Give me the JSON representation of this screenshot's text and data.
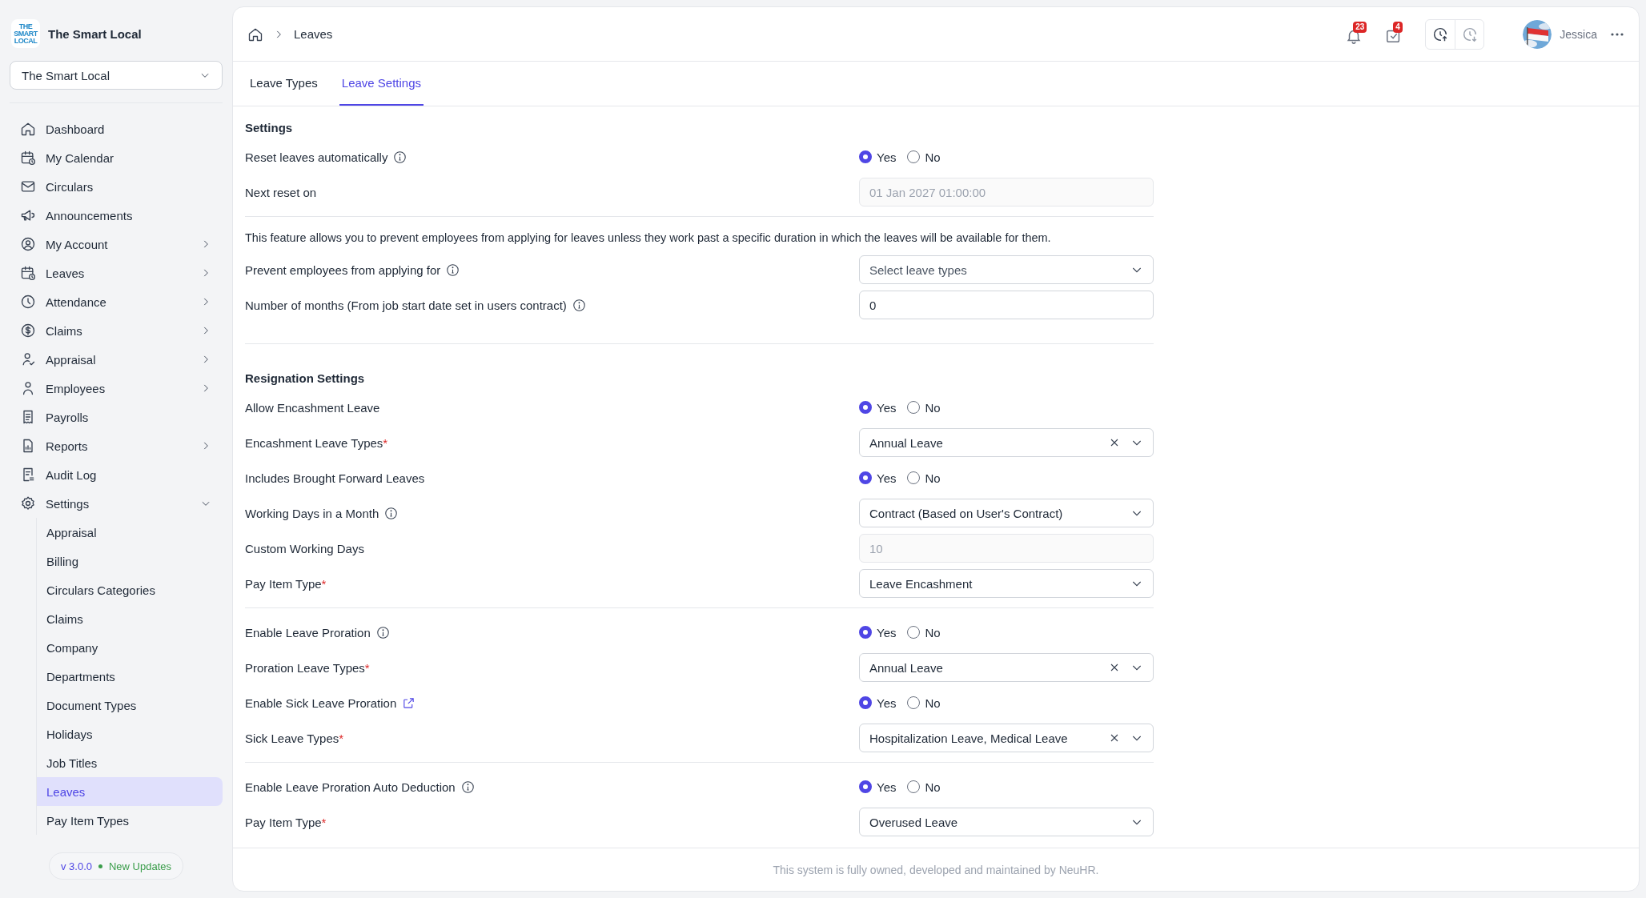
{
  "brand": {
    "logo_text": "THE SMART LOCAL",
    "name": "The Smart Local"
  },
  "company_select": {
    "value": "The Smart Local"
  },
  "sidebar": {
    "items": [
      {
        "label": "Dashboard"
      },
      {
        "label": "My Calendar"
      },
      {
        "label": "Circulars"
      },
      {
        "label": "Announcements"
      },
      {
        "label": "My Account",
        "expanded": false
      },
      {
        "label": "Leaves",
        "expanded": false
      },
      {
        "label": "Attendance",
        "expanded": false
      },
      {
        "label": "Claims",
        "expanded": false
      },
      {
        "label": "Appraisal",
        "expanded": false
      },
      {
        "label": "Employees",
        "expanded": false
      },
      {
        "label": "Payrolls"
      },
      {
        "label": "Reports",
        "expanded": false
      },
      {
        "label": "Audit Log"
      },
      {
        "label": "Settings",
        "expanded": true,
        "children": [
          {
            "label": "Appraisal",
            "selected": false
          },
          {
            "label": "Billing",
            "selected": false
          },
          {
            "label": "Circulars Categories",
            "selected": false
          },
          {
            "label": "Claims",
            "selected": false
          },
          {
            "label": "Company",
            "selected": false
          },
          {
            "label": "Departments",
            "selected": false
          },
          {
            "label": "Document Types",
            "selected": false
          },
          {
            "label": "Holidays",
            "selected": false
          },
          {
            "label": "Job Titles",
            "selected": false
          },
          {
            "label": "Leaves",
            "selected": true
          },
          {
            "label": "Pay Item Types",
            "selected": false
          }
        ]
      }
    ]
  },
  "version": {
    "number": "v 3.0.0",
    "note": "New Updates"
  },
  "breadcrumb": [
    "Leaves"
  ],
  "header": {
    "notifications": "23",
    "tasks": "4",
    "user": "Jessica"
  },
  "tabs": [
    {
      "label": "Leave Types",
      "selected": false
    },
    {
      "label": "Leave Settings",
      "selected": true
    }
  ],
  "form": [
    {
      "kind": "heading",
      "label": "Settings"
    },
    {
      "kind": "radio",
      "label": "Reset leaves automatically",
      "info": true,
      "options": [
        {
          "label": "Yes",
          "selected": true
        },
        {
          "label": "No",
          "selected": false
        }
      ]
    },
    {
      "kind": "input",
      "label": "Next reset on",
      "value": "01 Jan 2027 01:00:00",
      "disabled": true
    },
    {
      "kind": "divider"
    },
    {
      "kind": "note",
      "text": "This feature allows you to prevent employees from applying for leaves unless they work past a specific duration in which the leaves will be available for them."
    },
    {
      "kind": "select",
      "label": "Prevent employees from applying for",
      "info": true,
      "placeholder": "Select leave types"
    },
    {
      "kind": "input",
      "label": "Number of months (From job start date set in users contract)",
      "info": true,
      "value": "0"
    },
    {
      "kind": "divider"
    },
    {
      "kind": "heading",
      "label": "Resignation Settings"
    },
    {
      "kind": "radio",
      "label": "Allow Encashment Leave",
      "options": [
        {
          "label": "Yes",
          "selected": true
        },
        {
          "label": "No",
          "selected": false
        }
      ]
    },
    {
      "kind": "select",
      "label": "Encashment Leave Types",
      "mark": "*",
      "value": "Annual Leave",
      "clearable": true
    },
    {
      "kind": "radio",
      "label": "Includes Brought Forward Leaves",
      "options": [
        {
          "label": "Yes",
          "selected": true
        },
        {
          "label": "No",
          "selected": false
        }
      ]
    },
    {
      "kind": "select",
      "label": "Working Days in a Month",
      "info": true,
      "value": "Contract (Based on User's Contract)"
    },
    {
      "kind": "input",
      "label": "Custom Working Days",
      "value": "10",
      "disabled": true
    },
    {
      "kind": "select",
      "label": "Pay Item Type",
      "mark": "*",
      "value": "Leave Encashment"
    },
    {
      "kind": "divider"
    },
    {
      "kind": "radio",
      "label": "Enable Leave Proration",
      "info": true,
      "options": [
        {
          "label": "Yes",
          "selected": true
        },
        {
          "label": "No",
          "selected": false
        }
      ]
    },
    {
      "kind": "select",
      "label": "Proration Leave Types",
      "mark": "*",
      "value": "Annual Leave",
      "clearable": true
    },
    {
      "kind": "radio",
      "label": "Enable Sick Leave Proration",
      "link": true,
      "options": [
        {
          "label": "Yes",
          "selected": true
        },
        {
          "label": "No",
          "selected": false
        }
      ]
    },
    {
      "kind": "select",
      "label": "Sick Leave Types",
      "mark": "*",
      "value": "Hospitalization Leave, Medical Leave",
      "clearable": true
    },
    {
      "kind": "divider"
    },
    {
      "kind": "radio",
      "label": "Enable Leave Proration Auto Deduction",
      "info": true,
      "options": [
        {
          "label": "Yes",
          "selected": true
        },
        {
          "label": "No",
          "selected": false
        }
      ]
    },
    {
      "kind": "select",
      "label": "Pay Item Type",
      "mark": "*",
      "value": "Overused Leave"
    }
  ],
  "footer": "This system is fully owned, developed and maintained by NeuHR."
}
